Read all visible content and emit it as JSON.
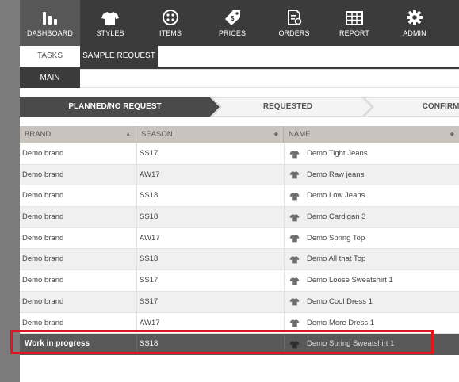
{
  "nav": {
    "items": [
      {
        "label": "DASHBOARD",
        "icon": "dashboard-bars-icon"
      },
      {
        "label": "STYLES",
        "icon": "shirt-icon"
      },
      {
        "label": "ITEMS",
        "icon": "button-icon"
      },
      {
        "label": "PRICES",
        "icon": "price-tag-icon"
      },
      {
        "label": "ORDERS",
        "icon": "order-document-icon"
      },
      {
        "label": "REPORT",
        "icon": "grid-report-icon"
      },
      {
        "label": "ADMIN",
        "icon": "gear-icon"
      }
    ]
  },
  "subnav": {
    "tasks_label": "TASKS",
    "sample_request_label": "SAMPLE REQUEST",
    "main_label": "MAIN"
  },
  "workflow": {
    "steps": [
      "PLANNED/NO REQUEST",
      "REQUESTED",
      "CONFIRMED"
    ]
  },
  "table": {
    "headers": {
      "brand": "BRAND",
      "season": "SEASON",
      "name": "NAME"
    },
    "rows": [
      {
        "brand": "Demo brand",
        "season": "SS17",
        "name": "Demo Tight Jeans"
      },
      {
        "brand": "Demo brand",
        "season": "AW17",
        "name": "Demo Raw jeans"
      },
      {
        "brand": "Demo brand",
        "season": "SS18",
        "name": "Demo Low Jeans"
      },
      {
        "brand": "Demo brand",
        "season": "SS18",
        "name": "Demo Cardigan 3"
      },
      {
        "brand": "Demo brand",
        "season": "AW17",
        "name": "Demo Spring Top"
      },
      {
        "brand": "Demo brand",
        "season": "SS18",
        "name": "Demo All that Top"
      },
      {
        "brand": "Demo brand",
        "season": "SS17",
        "name": "Demo Loose Sweatshirt 1"
      },
      {
        "brand": "Demo brand",
        "season": "SS17",
        "name": "Demo Cool Dress 1"
      },
      {
        "brand": "Demo brand",
        "season": "AW17",
        "name": "Demo More Dress 1"
      },
      {
        "brand": "Work in progress",
        "season": "SS18",
        "name": "Demo Spring Sweatshirt 1"
      }
    ]
  },
  "colors": {
    "nav_bg": "#3b3b3b",
    "nav_active": "#575757",
    "header_bg": "#c8c3bc",
    "selected_row": "#595959",
    "highlight": "#e3141c"
  }
}
